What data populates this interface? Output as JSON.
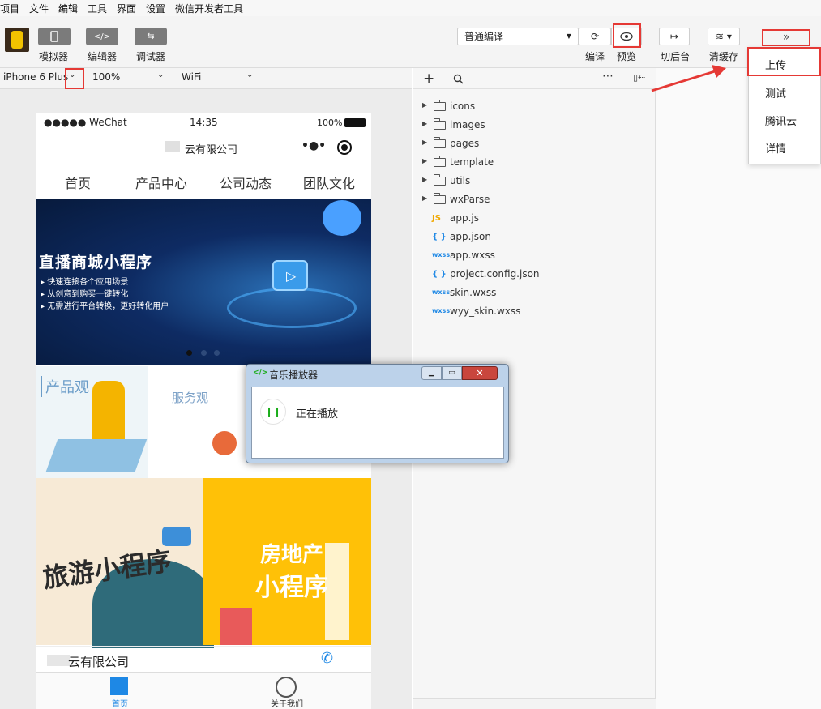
{
  "menubar": {
    "items": [
      "项目",
      "文件",
      "编辑",
      "工具",
      "界面",
      "设置",
      "微信开发者工具"
    ]
  },
  "toolbar": {
    "left_buttons": [
      {
        "label": "模拟器",
        "icon": "phone-icon"
      },
      {
        "label": "编辑器",
        "icon": "code-icon"
      },
      {
        "label": "调试器",
        "icon": "sliders-icon"
      }
    ],
    "compile_mode": "普通编译",
    "compile_label": "编译",
    "preview_label": "预览",
    "background_label": "切后台",
    "cache_label": "清缓存",
    "more_icon": "double-chevron-right-icon"
  },
  "devbar": {
    "device": "iPhone 6 Plus",
    "zoom": "100%",
    "network": "WiFi"
  },
  "phone": {
    "status": {
      "carrier": "●●●●● WeChat",
      "time": "14:35",
      "battery": "100%"
    },
    "title": "云有限公司",
    "tabs": [
      "首页",
      "产品中心",
      "公司动态",
      "团队文化"
    ],
    "banner": {
      "title": "直播商城小程序",
      "lines": [
        "快速连接各个应用场景",
        "从创意到购买一键转化",
        "无需进行平台转换，更好转化用户"
      ]
    },
    "tiles": {
      "product_view": "产品观",
      "service_view": "服务观",
      "travel": "旅游小程序",
      "realestate_1": "房地产",
      "realestate_2": "小程序"
    },
    "footer_company": "云有限公司",
    "bottom_tabs": [
      "首页",
      "关于我们"
    ]
  },
  "filetree": {
    "folders": [
      "icons",
      "images",
      "pages",
      "template",
      "utils",
      "wxParse"
    ],
    "files": [
      {
        "name": "app.js",
        "tag": "JS"
      },
      {
        "name": "app.json",
        "tag": "{ }"
      },
      {
        "name": "app.wxss",
        "tag": "wxss"
      },
      {
        "name": "project.config.json",
        "tag": "{ }"
      },
      {
        "name": "skin.wxss",
        "tag": "wxss"
      },
      {
        "name": "wyy_skin.wxss",
        "tag": "wxss"
      }
    ],
    "header_icons": [
      "plus-icon",
      "search-icon",
      "more-icon",
      "collapse-icon"
    ]
  },
  "dropdown": {
    "items": [
      "上传",
      "测试",
      "腾讯云",
      "详情"
    ]
  },
  "dialog": {
    "title": "音乐播放器",
    "status": "正在播放",
    "controls": [
      "minimize-icon",
      "maximize-icon",
      "close-icon"
    ]
  },
  "colors": {
    "highlight": "#e53935",
    "button_gray": "#7b7b7b",
    "banner_bg": "#0a1f4a",
    "accent_blue": "#1e88e5",
    "realestate_bg": "#ffc107"
  }
}
